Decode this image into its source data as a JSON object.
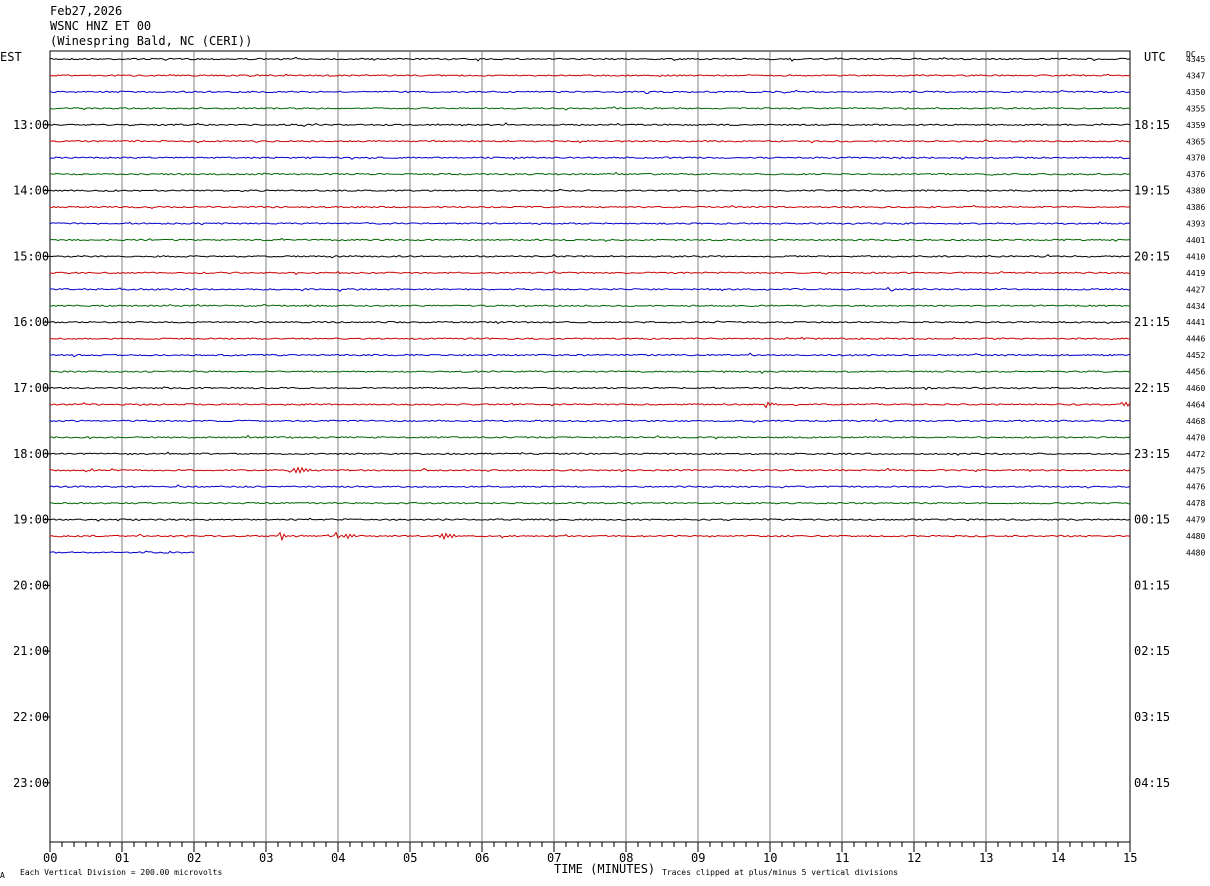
{
  "header": {
    "date": "Feb27,2026",
    "station": "WSNC HNZ ET 00",
    "location": "(Winespring Bald, NC (CERI))"
  },
  "left_label": "EST",
  "right_label": "UTC",
  "dc_label": "DC",
  "footer": {
    "xlabel": "TIME (MINUTES)",
    "scale_note": "Each Vertical Division =  200.00 microvolts",
    "clip_note": "Traces clipped at plus/minus 5 vertical divisions",
    "corner_mark": "A"
  },
  "colors": {
    "cycle": [
      "#000000",
      "#cc0000",
      "#0000cc",
      "#006600"
    ],
    "grid": "#808080"
  },
  "chart_data": {
    "type": "line",
    "title": "WSNC HNZ ET 00",
    "xlabel": "TIME (MINUTES)",
    "x_ticks": [
      "00",
      "01",
      "02",
      "03",
      "04",
      "05",
      "06",
      "07",
      "08",
      "09",
      "10",
      "11",
      "12",
      "13",
      "14",
      "15"
    ],
    "xlim": [
      0,
      15
    ],
    "est_hour_labels": [
      "13:00",
      "14:00",
      "15:00",
      "16:00",
      "17:00",
      "18:00",
      "19:00",
      "20:00",
      "21:00",
      "22:00",
      "23:00"
    ],
    "utc_hour_labels": [
      "18:15",
      "19:15",
      "20:15",
      "21:15",
      "22:15",
      "23:15",
      "00:15",
      "01:15",
      "02:15",
      "03:15",
      "04:15"
    ],
    "dc_values": [
      "4345",
      "4347",
      "4350",
      "4355",
      "4359",
      "4365",
      "4370",
      "4376",
      "4380",
      "4386",
      "4393",
      "4401",
      "4410",
      "4419",
      "4427",
      "4434",
      "4441",
      "4446",
      "4452",
      "4456",
      "4460",
      "4464",
      "4468",
      "4470",
      "4472",
      "4475",
      "4476",
      "4478",
      "4479",
      "4480",
      "4480"
    ],
    "rows_total": 31,
    "last_row_end_minute": 2,
    "events": [
      {
        "row": 25,
        "minute": 3.35,
        "amp": 8
      },
      {
        "row": 29,
        "minute": 3.2,
        "amp": 4
      },
      {
        "row": 29,
        "minute": 4.0,
        "amp": 7
      },
      {
        "row": 29,
        "minute": 5.4,
        "amp": 6
      },
      {
        "row": 21,
        "minute": 9.95,
        "amp": 3
      },
      {
        "row": 21,
        "minute": 14.9,
        "amp": 3
      }
    ]
  }
}
